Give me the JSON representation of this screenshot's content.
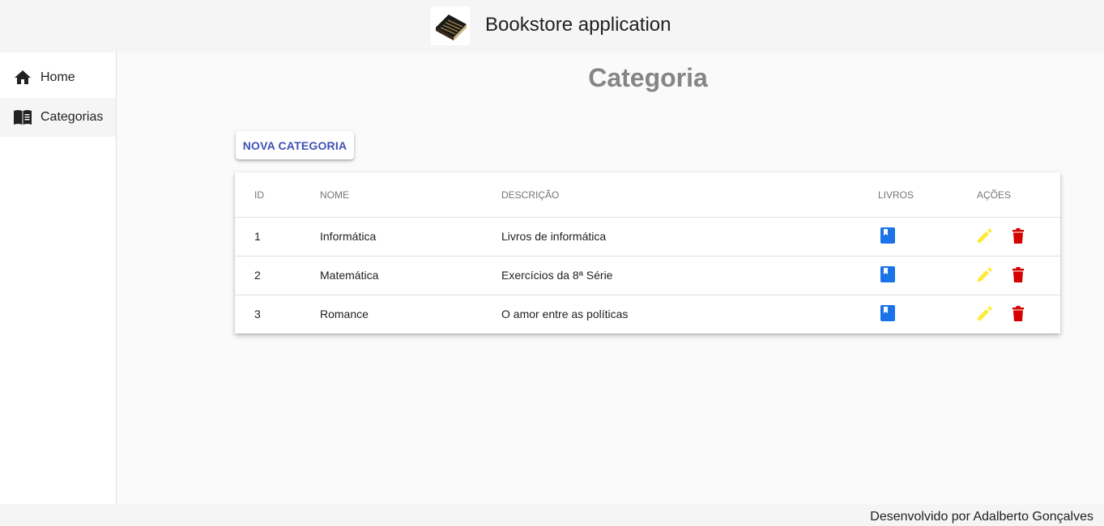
{
  "header": {
    "title": "Bookstore application",
    "logo_icon": "book-logo-icon"
  },
  "sidebar": {
    "items": [
      {
        "label": "Home",
        "icon": "home-icon"
      },
      {
        "label": "Categorias",
        "icon": "menu-book-icon"
      }
    ]
  },
  "main": {
    "title": "Categoria",
    "new_button_label": "NOVA CATEGORIA",
    "table": {
      "columns": [
        "ID",
        "NOME",
        "DESCRIÇÃO",
        "LIVROS",
        "AÇÕES"
      ],
      "rows": [
        {
          "id": "1",
          "nome": "Informática",
          "descricao": "Livros de informática"
        },
        {
          "id": "2",
          "nome": "Matemática",
          "descricao": "Exercícios da 8ª Série"
        },
        {
          "id": "3",
          "nome": "Romance",
          "descricao": "O amor entre as políticas"
        }
      ]
    }
  },
  "footer": {
    "text": "Desenvolvido por Adalberto Gonçalves"
  },
  "colors": {
    "accent": "#3f51b5",
    "book_icon": "#1a73e8",
    "edit_icon": "#ffeb3b",
    "delete_icon": "#d50000",
    "title_gray": "#858585"
  }
}
